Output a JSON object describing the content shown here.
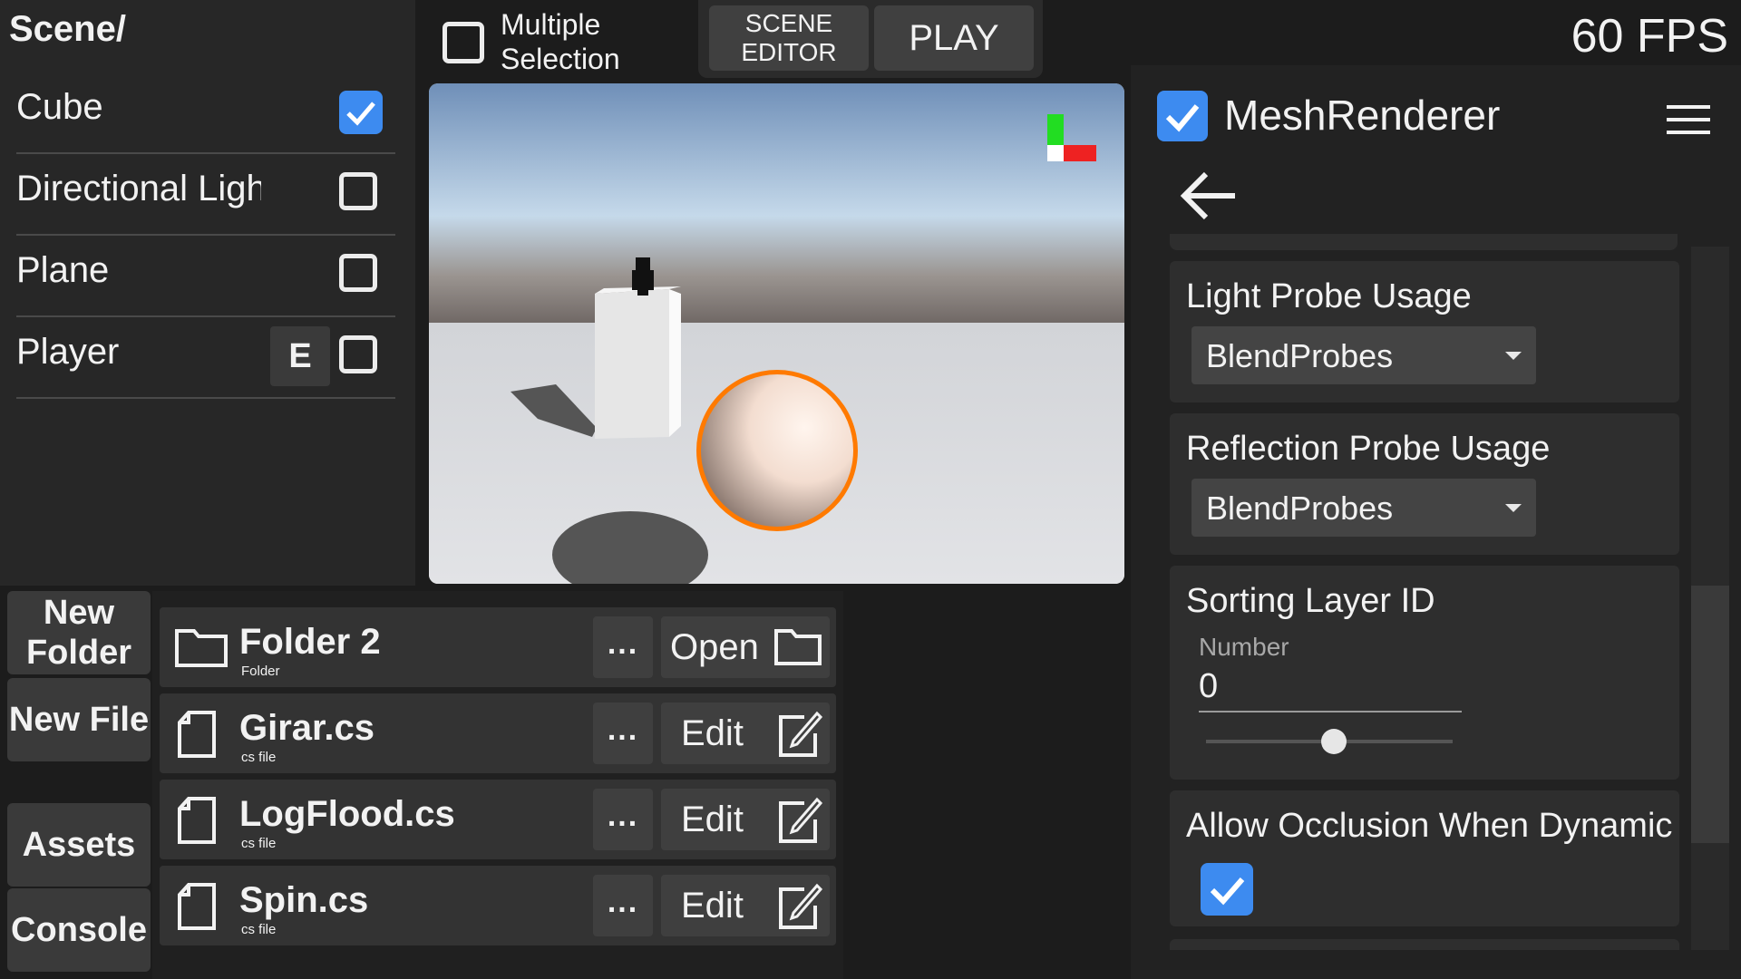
{
  "hierarchy": {
    "title": "Scene/",
    "items": [
      {
        "label": "Cube",
        "checked": true
      },
      {
        "label": "Directional Light",
        "checked": false
      },
      {
        "label": "Plane",
        "checked": false
      },
      {
        "label": "Player",
        "checked": false,
        "edit_label": "E"
      }
    ]
  },
  "toolbar": {
    "multi_selection_label": "Multiple Selection",
    "multi_selection_checked": false,
    "scene_editor_label": "SCENE EDITOR",
    "play_label": "PLAY",
    "fps": "60 FPS"
  },
  "side_tabs": {
    "new_folder": "New Folder",
    "new_file": "New File",
    "assets": "Assets",
    "console": "Console"
  },
  "files": [
    {
      "name": "Folder 2",
      "type": "Folder",
      "icon": "folder-icon",
      "action": "Open",
      "action_icon": "folder-icon",
      "more": "..."
    },
    {
      "name": "Girar.cs",
      "type": "cs file",
      "icon": "file-icon",
      "action": "Edit",
      "action_icon": "edit-icon",
      "more": "..."
    },
    {
      "name": "LogFlood.cs",
      "type": "cs file",
      "icon": "file-icon",
      "action": "Edit",
      "action_icon": "edit-icon",
      "more": "..."
    },
    {
      "name": "Spin.cs",
      "type": "cs file",
      "icon": "file-icon",
      "action": "Edit",
      "action_icon": "edit-icon",
      "more": "..."
    }
  ],
  "inspector": {
    "component_name": "MeshRenderer",
    "component_enabled": true,
    "menu_icon": "hamburger-icon",
    "back_icon": "back-arrow-icon",
    "properties": {
      "light_probe": {
        "label": "Light Probe Usage",
        "value": "BlendProbes"
      },
      "reflection_probe": {
        "label": "Reflection Probe Usage",
        "value": "BlendProbes"
      },
      "sorting_layer": {
        "label": "Sorting Layer ID",
        "sublabel": "Number",
        "value": "0",
        "slider_fraction": 0.52
      },
      "allow_occlusion": {
        "label": "Allow Occlusion When Dynamic",
        "checked": true
      }
    }
  },
  "colors": {
    "accent": "#3d8bf0",
    "selection_outline": "#ff7a00",
    "gizmo_y": "#22dd22",
    "gizmo_x": "#ee2222"
  }
}
